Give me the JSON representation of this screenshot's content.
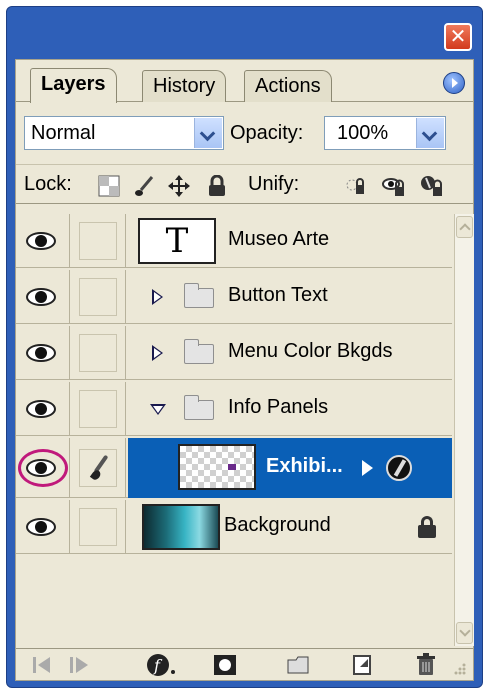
{
  "tabs": [
    {
      "label": "Layers",
      "active": true
    },
    {
      "label": "History",
      "active": false
    },
    {
      "label": "Actions",
      "active": false
    }
  ],
  "blend": {
    "mode": "Normal",
    "opacity_label": "Opacity:",
    "opacity_value": "100%"
  },
  "lock_row": {
    "lock_label": "Lock:",
    "unify_label": "Unify:"
  },
  "layers": [
    {
      "name": "Museo Arte",
      "type": "text",
      "thumb_glyph": "T"
    },
    {
      "name": "Button Text",
      "type": "group",
      "expanded": false
    },
    {
      "name": "Menu Color Bkgds",
      "type": "group",
      "expanded": false
    },
    {
      "name": "Info Panels",
      "type": "group",
      "expanded": true
    },
    {
      "name": "Exhibi...",
      "type": "layer",
      "selected": true,
      "has_effects": true
    },
    {
      "name": "Background",
      "type": "background",
      "locked": true
    }
  ],
  "colors": {
    "window_frame": "#2e5fb8",
    "panel_bg": "#ece8d7",
    "selection": "#0a5fb6",
    "highlight_ring": "#c0197b",
    "close_button": "#d23a1d"
  },
  "icons": [
    "close-icon",
    "panel-menu-icon",
    "eye-icon",
    "brush-icon",
    "folder-icon",
    "padlock-icon",
    "fx-icon",
    "trash-icon",
    "new-layer-icon",
    "new-group-icon",
    "mask-icon"
  ]
}
